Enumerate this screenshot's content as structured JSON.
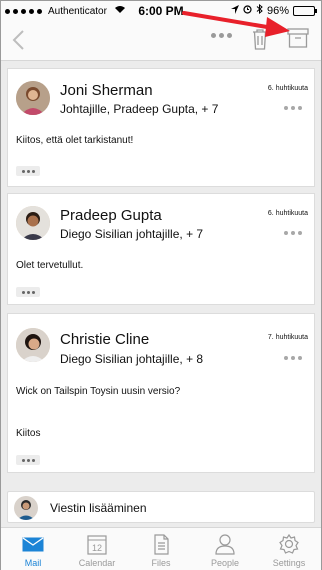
{
  "status_bar": {
    "carrier": "Authenticator",
    "time": "6:00 PM",
    "battery_percent": "96%",
    "battery_level": 0.96
  },
  "cards": [
    {
      "sender": "Joni Sherman",
      "recipients": "Johtajille, Pradeep Gupta, + 7",
      "date": "6. huhtikuuta",
      "body_lines": [
        "Kiitos, että olet tarkistanut!"
      ]
    },
    {
      "sender": "Pradeep Gupta",
      "recipients": "Diego Sisilian johtajille, + 7",
      "date": "6. huhtikuuta",
      "body_lines": [
        "Olet tervetullut."
      ]
    },
    {
      "sender": "Christie Cline",
      "recipients": "Diego Sisilian johtajille, + 8",
      "date": "7. huhtikuuta",
      "body_lines": [
        "Wick on Tailspin Toysin uusin versio?",
        "Kiitos"
      ]
    }
  ],
  "compose": {
    "label": "Viestin lisääminen"
  },
  "tabs": [
    {
      "label": "Mail",
      "icon": "mail-icon",
      "active": true
    },
    {
      "label": "Calendar",
      "icon": "calendar-icon",
      "active": false,
      "badge": "12"
    },
    {
      "label": "Files",
      "icon": "files-icon",
      "active": false
    },
    {
      "label": "People",
      "icon": "people-icon",
      "active": false
    },
    {
      "label": "Settings",
      "icon": "settings-icon",
      "active": false
    }
  ],
  "colors": {
    "accent": "#1c84d6",
    "arrow": "#e8202a"
  }
}
